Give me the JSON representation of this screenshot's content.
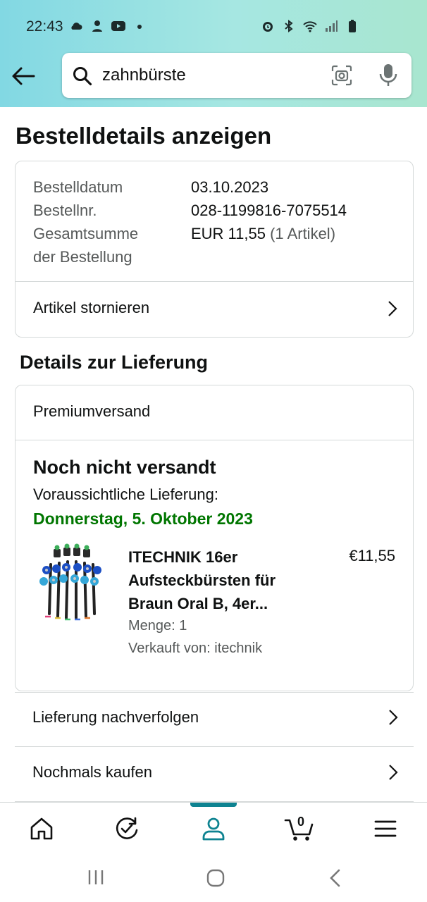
{
  "status_bar": {
    "time": "22:43",
    "left_icons": [
      "cloud-icon",
      "incognito-icon",
      "youtube-icon",
      "dot-icon"
    ],
    "right_icons": [
      "alarm-icon",
      "bluetooth-icon",
      "wifi-icon",
      "signal-icon",
      "battery-icon"
    ]
  },
  "search": {
    "query": "zahnbürste"
  },
  "page": {
    "title": "Bestelldetails anzeigen"
  },
  "order_summary": {
    "rows": [
      {
        "label": "Bestelldatum",
        "value": "03.10.2023"
      },
      {
        "label": "Bestellnr.",
        "value": "028-1199816-7075514"
      },
      {
        "label_line1": "Gesamtsumme",
        "label_line2": "der Bestellung",
        "value": "EUR 11,55",
        "value_note": "(1 Artikel)"
      }
    ],
    "cancel_label": "Artikel stornieren"
  },
  "delivery": {
    "section_title": "Details zur Lieferung",
    "shipping_method": "Premiumversand",
    "status": "Noch nicht versandt",
    "eta_label": "Voraussichtliche Lieferung:",
    "eta_date": "Donnerstag, 5. Oktober 2023",
    "product": {
      "title": "ITECHNIK 16er Aufsteckbürsten für Braun Oral B, 4er...",
      "price": "€11,55",
      "quantity": "Menge: 1",
      "seller": "Verkauft von: itechnik"
    }
  },
  "actions": [
    {
      "label": "Lieferung nachverfolgen"
    },
    {
      "label": "Nochmals kaufen"
    }
  ],
  "bottom_nav": {
    "items": [
      "home-icon",
      "orders-icon",
      "account-icon",
      "cart-icon",
      "menu-icon"
    ],
    "cart_count": "0",
    "active": "account-icon",
    "accent_color": "#0e8391"
  },
  "colors": {
    "green_date": "#007600",
    "muted_text": "#565959",
    "border": "#d5d9d9"
  }
}
